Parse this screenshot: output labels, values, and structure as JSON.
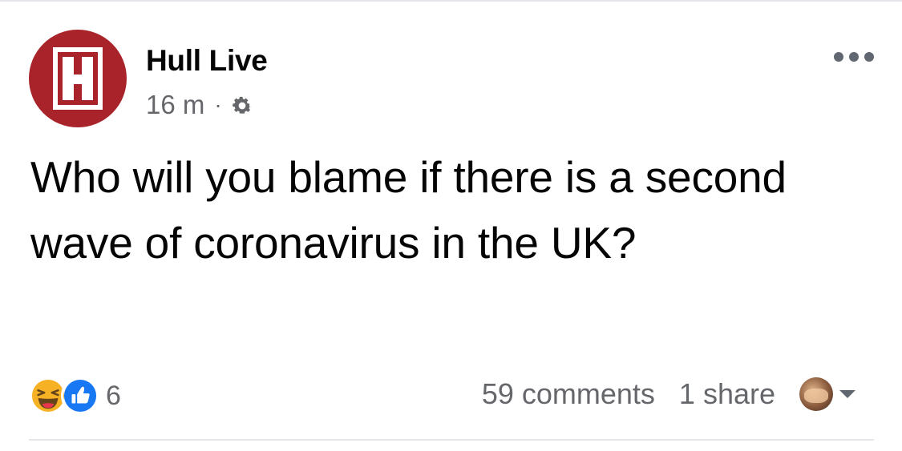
{
  "post": {
    "page_name": "Hull Live",
    "avatar_letter": "H",
    "timestamp": "16 m",
    "separator": "·",
    "audience_icon": "gear-icon",
    "text": "Who will you blame if there is a second wave of coronavirus in the UK?",
    "more_icon": "more-horizontal-icon"
  },
  "footer": {
    "reaction_icons": [
      "haha-icon",
      "like-icon"
    ],
    "reaction_count": "6",
    "comments": "59 comments",
    "shares": "1 share",
    "reaction_menu_icon": "chevron-down-icon"
  },
  "colors": {
    "brand_red": "#a8242a",
    "like_blue": "#1877f2",
    "haha_yellow": "#f7b125",
    "secondary_text": "#65676b",
    "divider": "#e4e6eb"
  }
}
